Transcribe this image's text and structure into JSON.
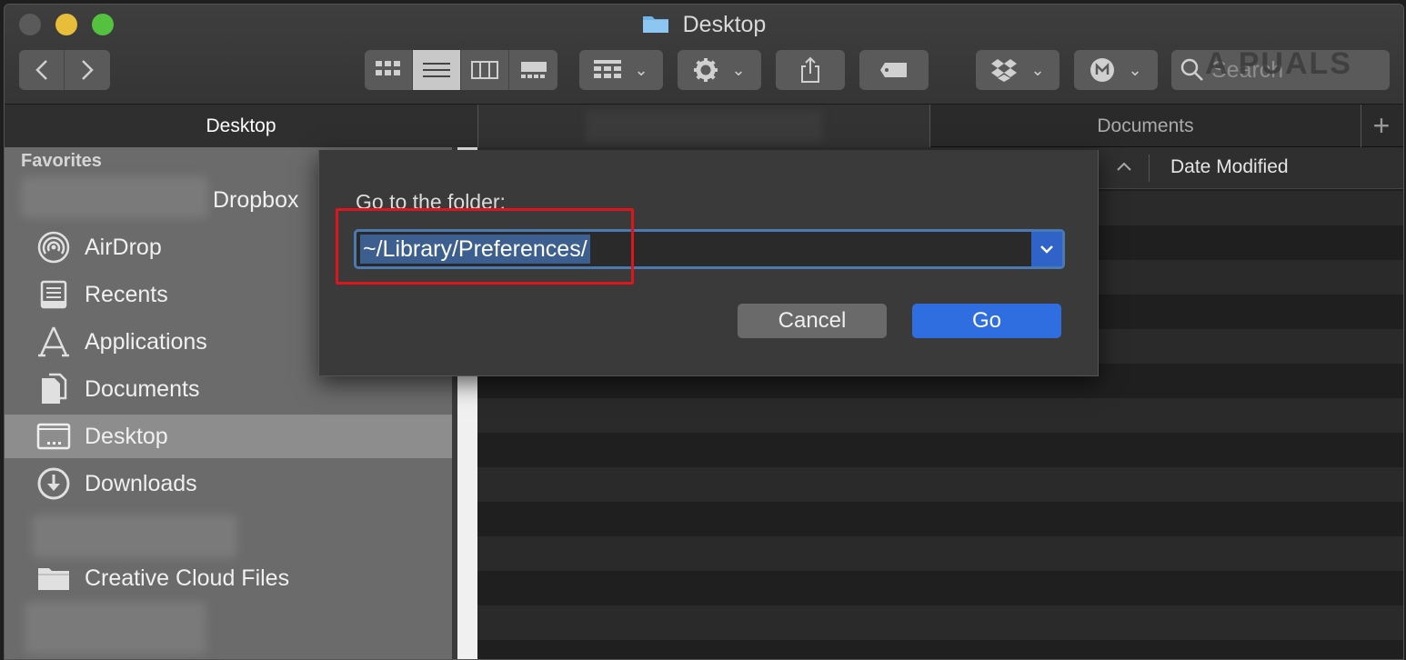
{
  "window": {
    "title": "Desktop"
  },
  "toolbar": {
    "search_placeholder": "Search",
    "watermark": "A PUALS"
  },
  "tabs": [
    {
      "label": "Desktop",
      "active": true
    },
    {
      "label": "",
      "blurred": true
    },
    {
      "label": "Documents",
      "active": false
    }
  ],
  "sidebar": {
    "section_title": "Favorites",
    "items": [
      {
        "label": "Dropbox",
        "icon": "dropbox-icon"
      },
      {
        "label": "AirDrop",
        "icon": "airdrop-icon"
      },
      {
        "label": "Recents",
        "icon": "recents-icon"
      },
      {
        "label": "Applications",
        "icon": "applications-icon"
      },
      {
        "label": "Documents",
        "icon": "documents-icon"
      },
      {
        "label": "Desktop",
        "icon": "desktop-icon",
        "selected": true
      },
      {
        "label": "Downloads",
        "icon": "downloads-icon"
      },
      {
        "label": "Creative Cloud Files",
        "icon": "folder-icon"
      }
    ]
  },
  "list": {
    "column_date": "Date Modified",
    "sort_indicator": "^"
  },
  "dialog": {
    "label": "Go to the folder:",
    "path_value": "~/Library/Preferences/",
    "cancel_label": "Cancel",
    "go_label": "Go"
  },
  "colors": {
    "accent": "#2f6ee0",
    "highlight": "#e0141b"
  }
}
